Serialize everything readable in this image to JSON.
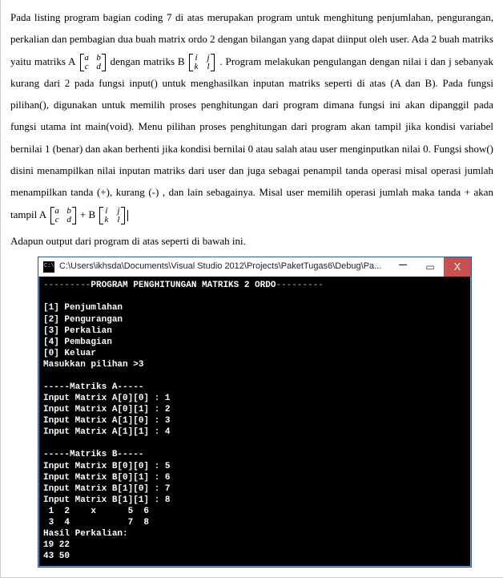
{
  "para": {
    "p1a": "Pada listing program bagian coding 7 di atas merupakan program untuk menghitung penjumlahan, pengurangan, perkalian dan pembagian dua buah matrix ordo 2 dengan bilangan yang dapat diinput oleh user. Ada 2 buah matriks yaitu matriks A ",
    "p1b": " dengan matriks B ",
    "p1c": ". Program melakukan pengulangan dengan nilai i dan j sebanyak kurang dari 2 pada fungsi input() untuk menghasilkan inputan matriks seperti di atas (A dan B).  Pada fungsi pilihan(), digunakan untuk memilih proses penghitungan dari program dimana fungsi ini akan dipanggil pada fungsi utama int main(void). Menu pilihan proses penghitungan dari program akan tampil jika kondisi variabel bernilai 1 (benar) dan akan berhenti jika kondisi bernilai 0 atau salah atau user menginputkan nilai 0.  Fungsi show() disini menampilkan nilai inputan matriks dari user dan juga sebagai penampil tanda operasi misal operasi jumlah menampilkan tanda (+), kurang (-) , dan lain sebagainya. Misal user memilih operasi jumlah maka tanda + akan tampil A ",
    "p1d": " + B ",
    "p2": "Adapun output dari program di atas seperti di bawah ini."
  },
  "matA": {
    "r1c1": "a",
    "r1c2": "b",
    "r2c1": "c",
    "r2c2": "d"
  },
  "matB": {
    "r1c1": "i",
    "r1c2": "j",
    "r2c1": "k",
    "r2c2": "l"
  },
  "window": {
    "title": "C:\\Users\\ikhsda\\Documents\\Visual Studio 2012\\Projects\\PaketTugas6\\Debug\\Pa...",
    "min": "–",
    "max": "▭",
    "close": "X"
  },
  "console": {
    "dash_l": "---------",
    "head": "PROGRAM PENGHITUNGAN MATRIKS 2 ORDO",
    "dash_r": "---------",
    "menu1": "[1] Penjumlahan",
    "menu2": "[2] Pengurangan",
    "menu3": "[3] Perkalian",
    "menu4": "[4] Pembagian",
    "menu0": "[0] Keluar",
    "prompt": "Masukkan pilihan >3",
    "secA": "-----Matriks A-----",
    "a00": "Input Matrix A[0][0] : 1",
    "a01": "Input Matrix A[0][1] : 2",
    "a10": "Input Matrix A[1][0] : 3",
    "a11": "Input Matrix A[1][1] : 4",
    "secB": "-----Matriks B-----",
    "b00": "Input Matrix B[0][0] : 5",
    "b01": "Input Matrix B[0][1] : 6",
    "b10": "Input Matrix B[1][0] : 7",
    "b11": "Input Matrix B[1][1] : 8",
    "row1": " 1  2    x      5  6",
    "row2": " 3  4           7  8",
    "res_lbl": "Hasil Perkalian:",
    "res1": "19 22",
    "res2": "43 50"
  }
}
